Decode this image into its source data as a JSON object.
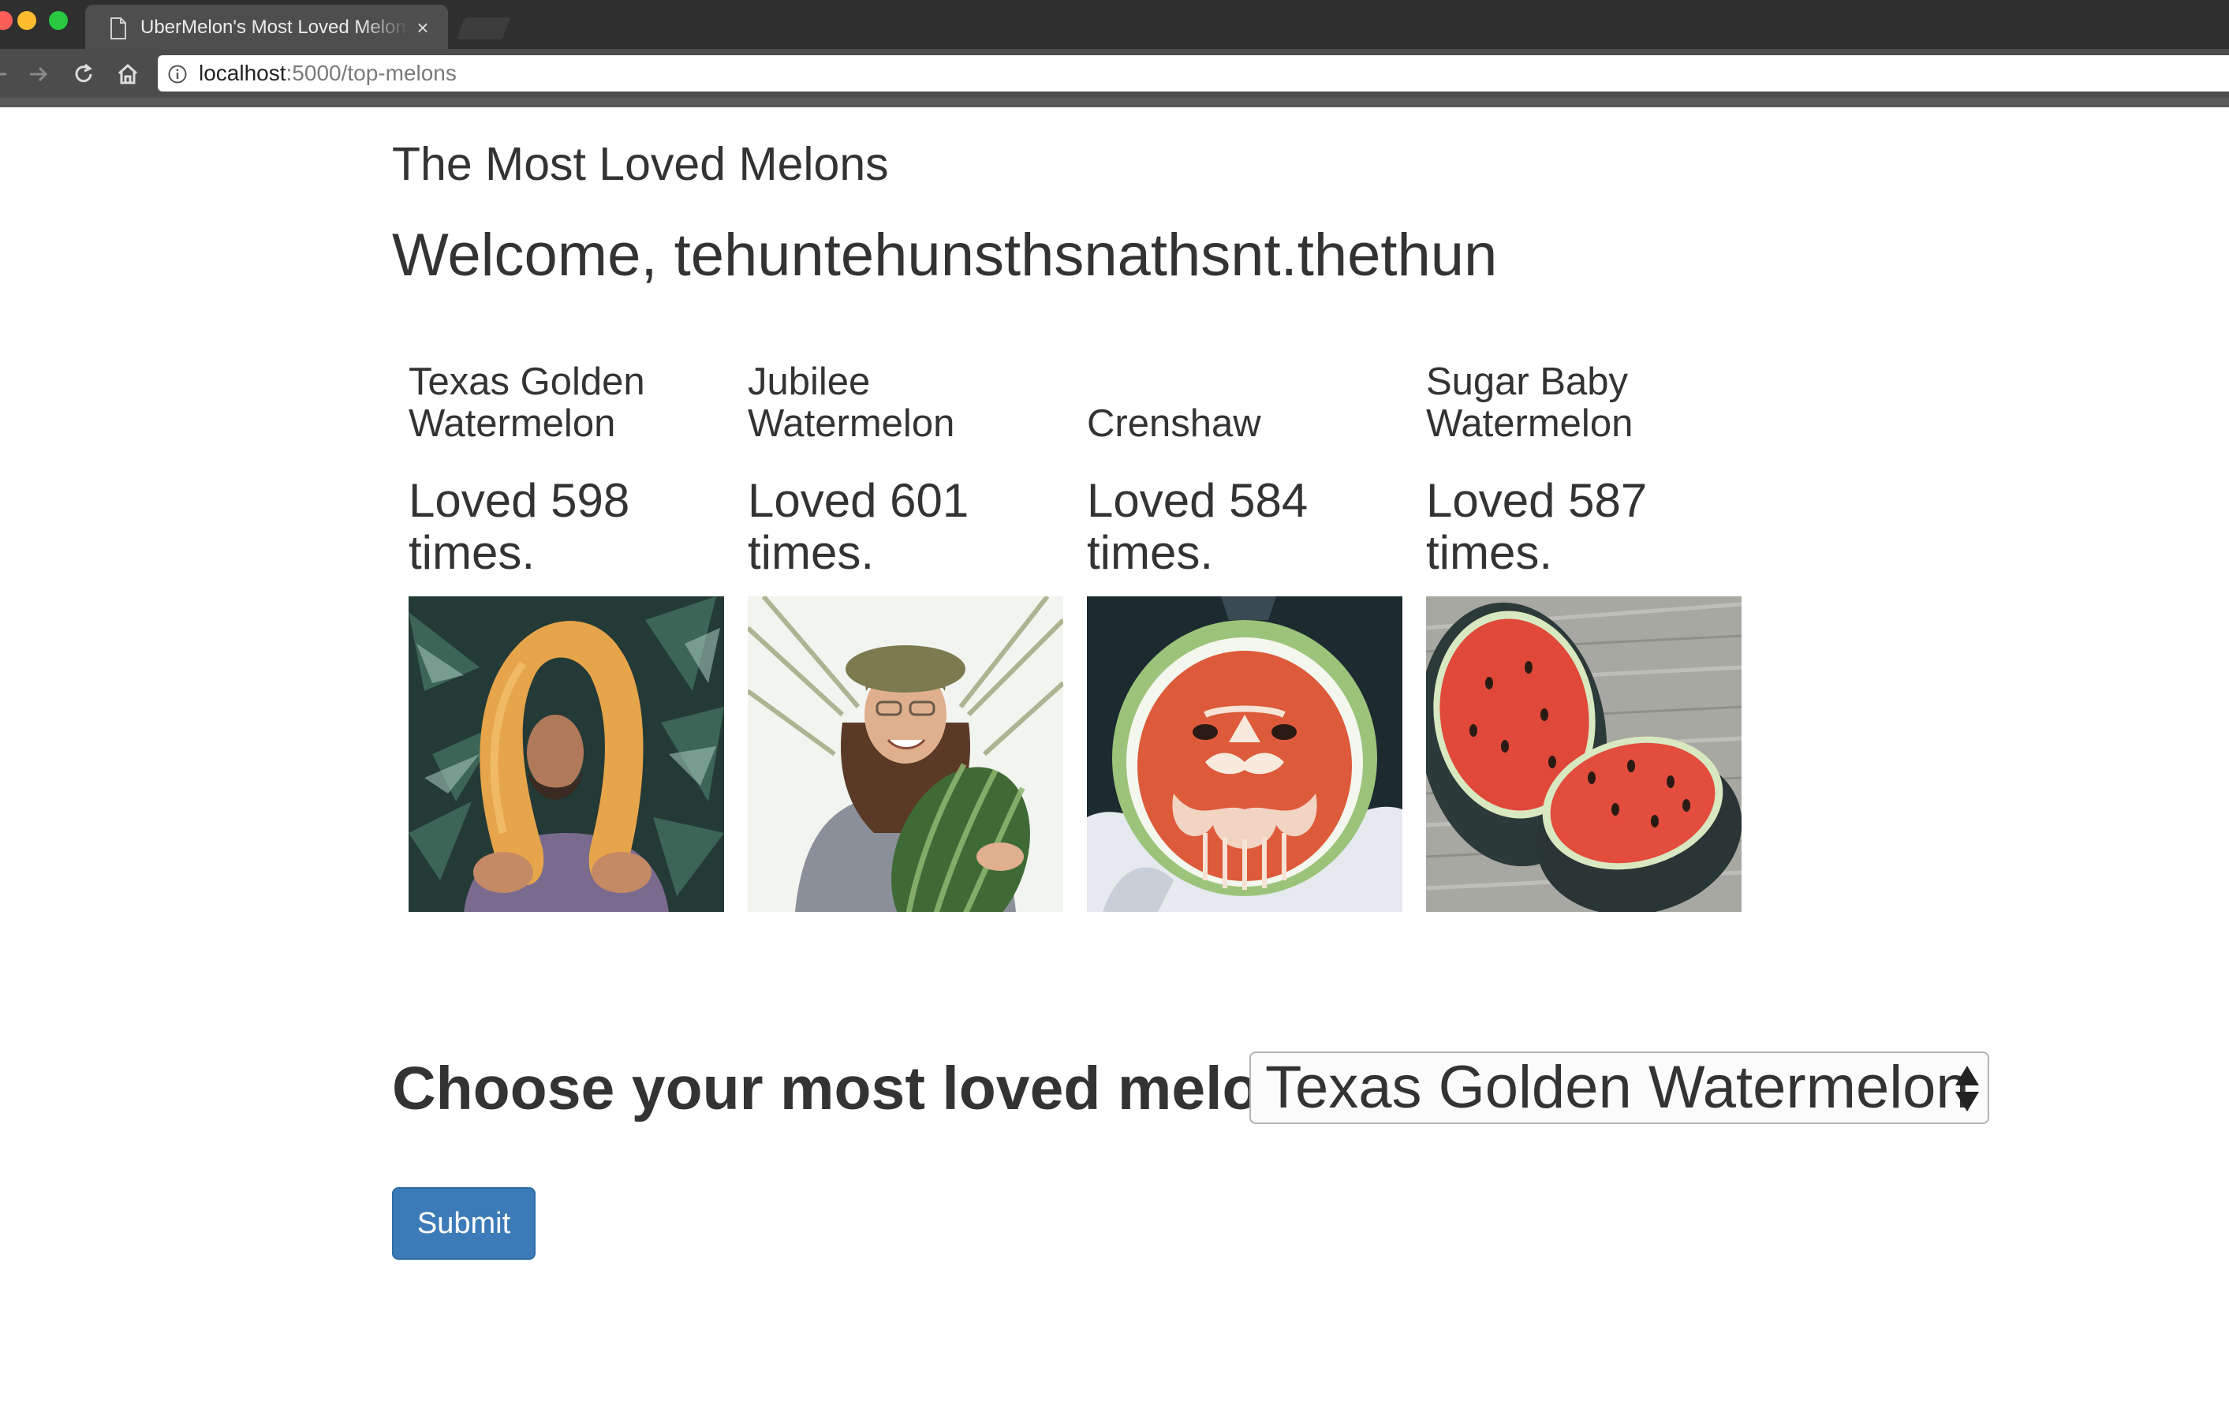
{
  "browser": {
    "tab_title": "UberMelon's Most Loved Melons",
    "tab_close": "×",
    "url_host": "localhost",
    "url_rest": ":5000/top-melons"
  },
  "page": {
    "title": "The Most Loved Melons",
    "welcome": "Welcome, tehuntehunsthsnathsnt.thethun"
  },
  "melons": [
    {
      "name": "Texas Golden Watermelon",
      "loves": "Loved 598 times.",
      "image": "texas-golden-photo"
    },
    {
      "name": "Jubilee Watermelon",
      "loves": "Loved 601 times.",
      "image": "jubilee-photo"
    },
    {
      "name": "Crenshaw",
      "loves": "Loved 584 times.",
      "image": "crenshaw-photo"
    },
    {
      "name": "Sugar Baby Watermelon",
      "loves": "Loved 587 times.",
      "image": "sugar-baby-photo"
    }
  ],
  "form": {
    "label": "Choose your most loved melon",
    "selected": "Texas Golden Watermelon",
    "submit_label": "Submit"
  },
  "icons": {
    "tab": "document-icon",
    "back": "back-arrow-icon",
    "forward": "forward-arrow-icon",
    "reload": "reload-icon",
    "home": "home-icon",
    "info": "info-icon",
    "select": "up-down-arrows-icon"
  },
  "colors": {
    "button": "#3d7bb8",
    "text": "#333333",
    "chrome": "#2f2f2f"
  }
}
